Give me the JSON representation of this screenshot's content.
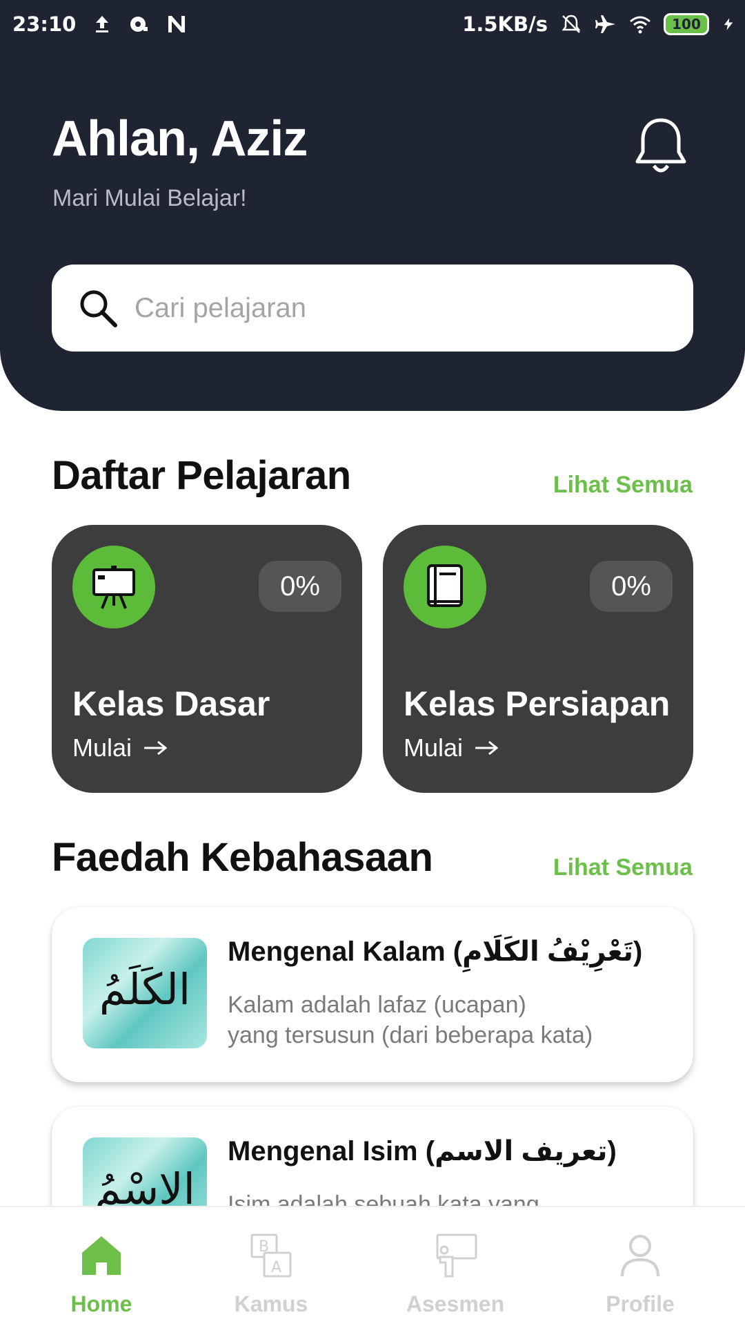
{
  "status_bar": {
    "time": "23:10",
    "speed": "1.5KB/s",
    "battery": "100",
    "icons": [
      "upload-icon",
      "record-icon",
      "n-icon",
      "mute-icon",
      "airplane-icon",
      "wifi-icon",
      "battery-icon",
      "charging-icon"
    ]
  },
  "header": {
    "greeting": "Ahlan, Aziz",
    "subtitle": "Mari Mulai Belajar!",
    "notification_icon": "bell-icon"
  },
  "search": {
    "placeholder": "Cari pelajaran",
    "value": ""
  },
  "lessons": {
    "title": "Daftar Pelajaran",
    "see_all": "Lihat Semua",
    "cards": [
      {
        "title": "Kelas Dasar",
        "progress": "0%",
        "progress_value": 0,
        "action": "Mulai",
        "icon": "presentation-board-icon"
      },
      {
        "title": "Kelas Persiapan",
        "progress": "0%",
        "progress_value": 0,
        "action": "Mulai",
        "icon": "book-icon"
      }
    ]
  },
  "faedah": {
    "title": "Faedah Kebahasaan",
    "see_all": "Lihat Semua",
    "items": [
      {
        "thumb_text": "الكَلَمُ",
        "title": "Mengenal Kalam (تَعْرِيْفُ الكَلَامِ)",
        "desc_line1": "Kalam adalah lafaz (ucapan)",
        "desc_line2": "yang tersusun (dari beberapa kata)"
      },
      {
        "thumb_text": "الاِسْمُ",
        "title": "Mengenal Isim (تعريف الاسم)",
        "desc_line1": "Isim adalah sebuah kata yang",
        "desc_line2": ""
      }
    ]
  },
  "nav": {
    "items": [
      {
        "label": "Home",
        "icon": "home-icon",
        "active": true
      },
      {
        "label": "Kamus",
        "icon": "dictionary-icon",
        "active": false
      },
      {
        "label": "Asesmen",
        "icon": "assessment-icon",
        "active": false
      },
      {
        "label": "Profile",
        "icon": "profile-icon",
        "active": false
      }
    ]
  },
  "colors": {
    "header_bg": "#1f2433",
    "accent": "#6cc04a",
    "card_bg": "#3d3d3d",
    "icon_circle": "#5dbb3a"
  }
}
